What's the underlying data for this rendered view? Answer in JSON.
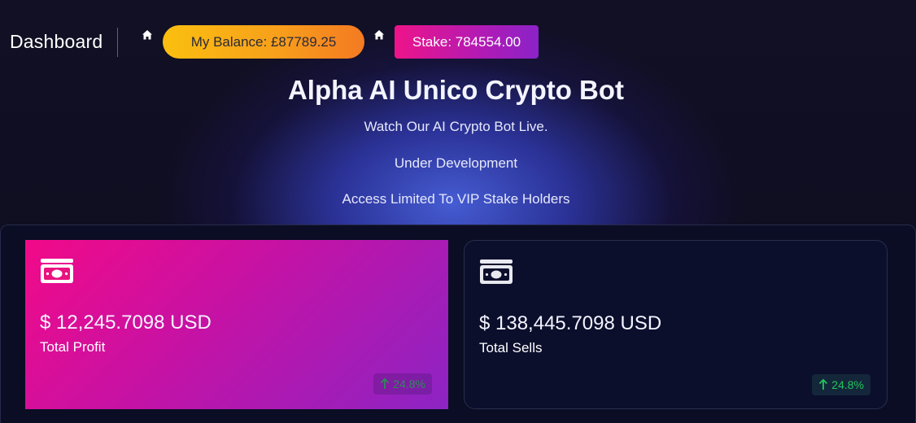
{
  "header": {
    "title": "Dashboard",
    "balance_label": "My Balance: £87789.25",
    "stake_label": "Stake: 784554.00"
  },
  "hero": {
    "title": "Alpha AI Unico Crypto Bot",
    "line1": "Watch Our AI Crypto Bot Live.",
    "line2": "Under Development",
    "line3": "Access Limited To VIP Stake Holders"
  },
  "cards": [
    {
      "value": "$ 12,245.7098 USD",
      "label": "Total Profit",
      "change": "24.8%",
      "icon": "money-bill-icon"
    },
    {
      "value": "$ 138,445.7098 USD",
      "label": "Total Sells",
      "change": "24.8%",
      "icon": "money-bill-icon"
    }
  ],
  "colors": {
    "balance_gradient": [
      "#fbbf0f",
      "#f47a22"
    ],
    "stake_gradient": [
      "#ee1489",
      "#8a23c8"
    ],
    "positive": "#22c55e"
  }
}
